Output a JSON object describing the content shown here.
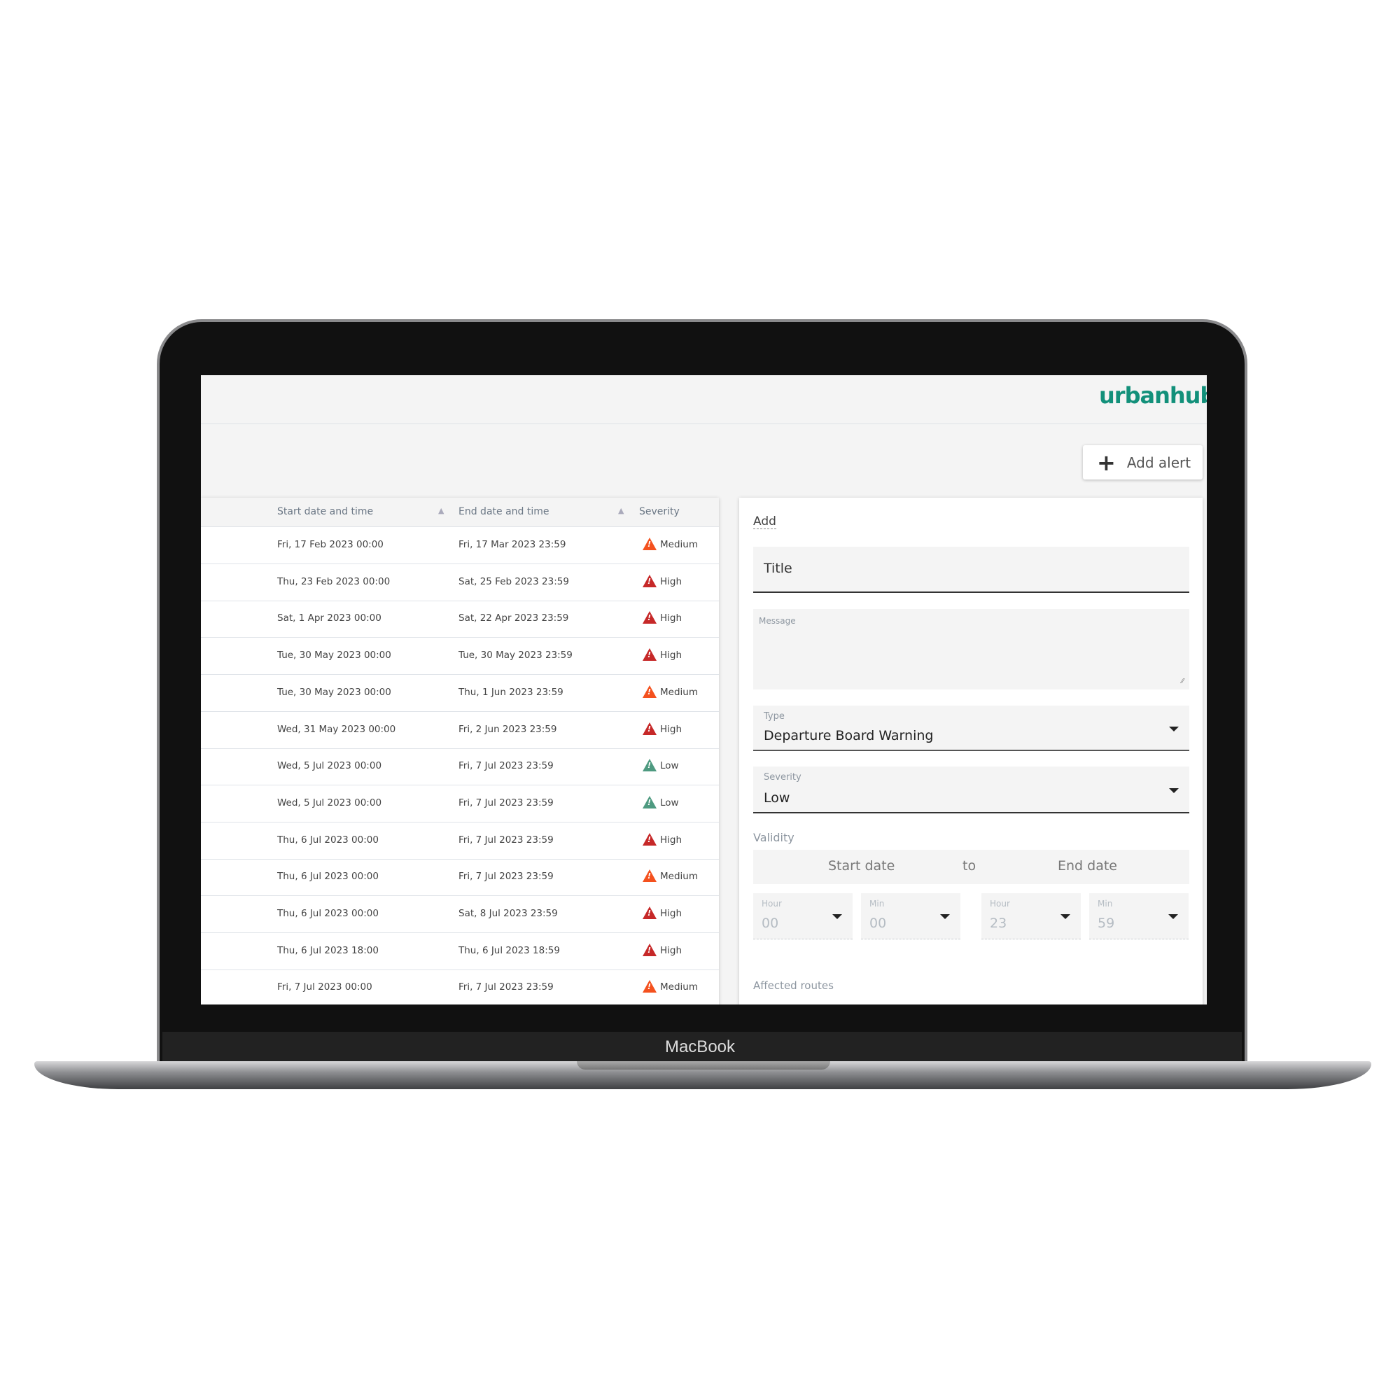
{
  "device": {
    "brand": "MacBook"
  },
  "header": {
    "logo": "urbanhub",
    "add_alert_label": "Add alert",
    "add_icon": "plus-icon"
  },
  "table": {
    "columns": [
      "Start date and time",
      "End date and time",
      "Severity"
    ],
    "rows": [
      {
        "start": "Fri, 17 Feb 2023 00:00",
        "end": "Fri, 17 Mar 2023 23:59",
        "severity": "Medium"
      },
      {
        "start": "Thu, 23 Feb 2023 00:00",
        "end": "Sat, 25 Feb 2023 23:59",
        "severity": "High"
      },
      {
        "start": "Sat, 1 Apr 2023 00:00",
        "end": "Sat, 22 Apr 2023 23:59",
        "severity": "High"
      },
      {
        "start": "Tue, 30 May 2023 00:00",
        "end": "Tue, 30 May 2023 23:59",
        "severity": "High"
      },
      {
        "start": "Tue, 30 May 2023 00:00",
        "end": "Thu, 1 Jun 2023 23:59",
        "severity": "Medium"
      },
      {
        "start": "Wed, 31 May 2023 00:00",
        "end": "Fri, 2 Jun 2023 23:59",
        "severity": "High"
      },
      {
        "start": "Wed, 5 Jul 2023 00:00",
        "end": "Fri, 7 Jul 2023 23:59",
        "severity": "Low"
      },
      {
        "start": "Wed, 5 Jul 2023 00:00",
        "end": "Fri, 7 Jul 2023 23:59",
        "severity": "Low"
      },
      {
        "start": "Thu, 6 Jul 2023 00:00",
        "end": "Fri, 7 Jul 2023 23:59",
        "severity": "High"
      },
      {
        "start": "Thu, 6 Jul 2023 00:00",
        "end": "Fri, 7 Jul 2023 23:59",
        "severity": "Medium"
      },
      {
        "start": "Thu, 6 Jul 2023 00:00",
        "end": "Sat, 8 Jul 2023 23:59",
        "severity": "High"
      },
      {
        "start": "Thu, 6 Jul 2023 18:00",
        "end": "Thu, 6 Jul 2023 18:59",
        "severity": "High"
      },
      {
        "start": "Fri, 7 Jul 2023 00:00",
        "end": "Fri, 7 Jul 2023 23:59",
        "severity": "Medium"
      }
    ],
    "severity_colors": {
      "High": "#c62828",
      "Medium": "#f4511e",
      "Low": "#4e9a80"
    }
  },
  "form": {
    "heading": "Add",
    "title_placeholder": "Title",
    "message_label": "Message",
    "type": {
      "label": "Type",
      "value": "Departure Board Warning"
    },
    "severity": {
      "label": "Severity",
      "value": "Low"
    },
    "validity_label": "Validity",
    "start_date_placeholder": "Start date",
    "to_label": "to",
    "end_date_placeholder": "End date",
    "time": [
      {
        "label": "Hour",
        "value": "00"
      },
      {
        "label": "Min",
        "value": "00"
      },
      {
        "label": "Hour",
        "value": "23"
      },
      {
        "label": "Min",
        "value": "59"
      }
    ],
    "affected_routes_label": "Affected routes"
  },
  "colors": {
    "brand": "#12907a"
  }
}
